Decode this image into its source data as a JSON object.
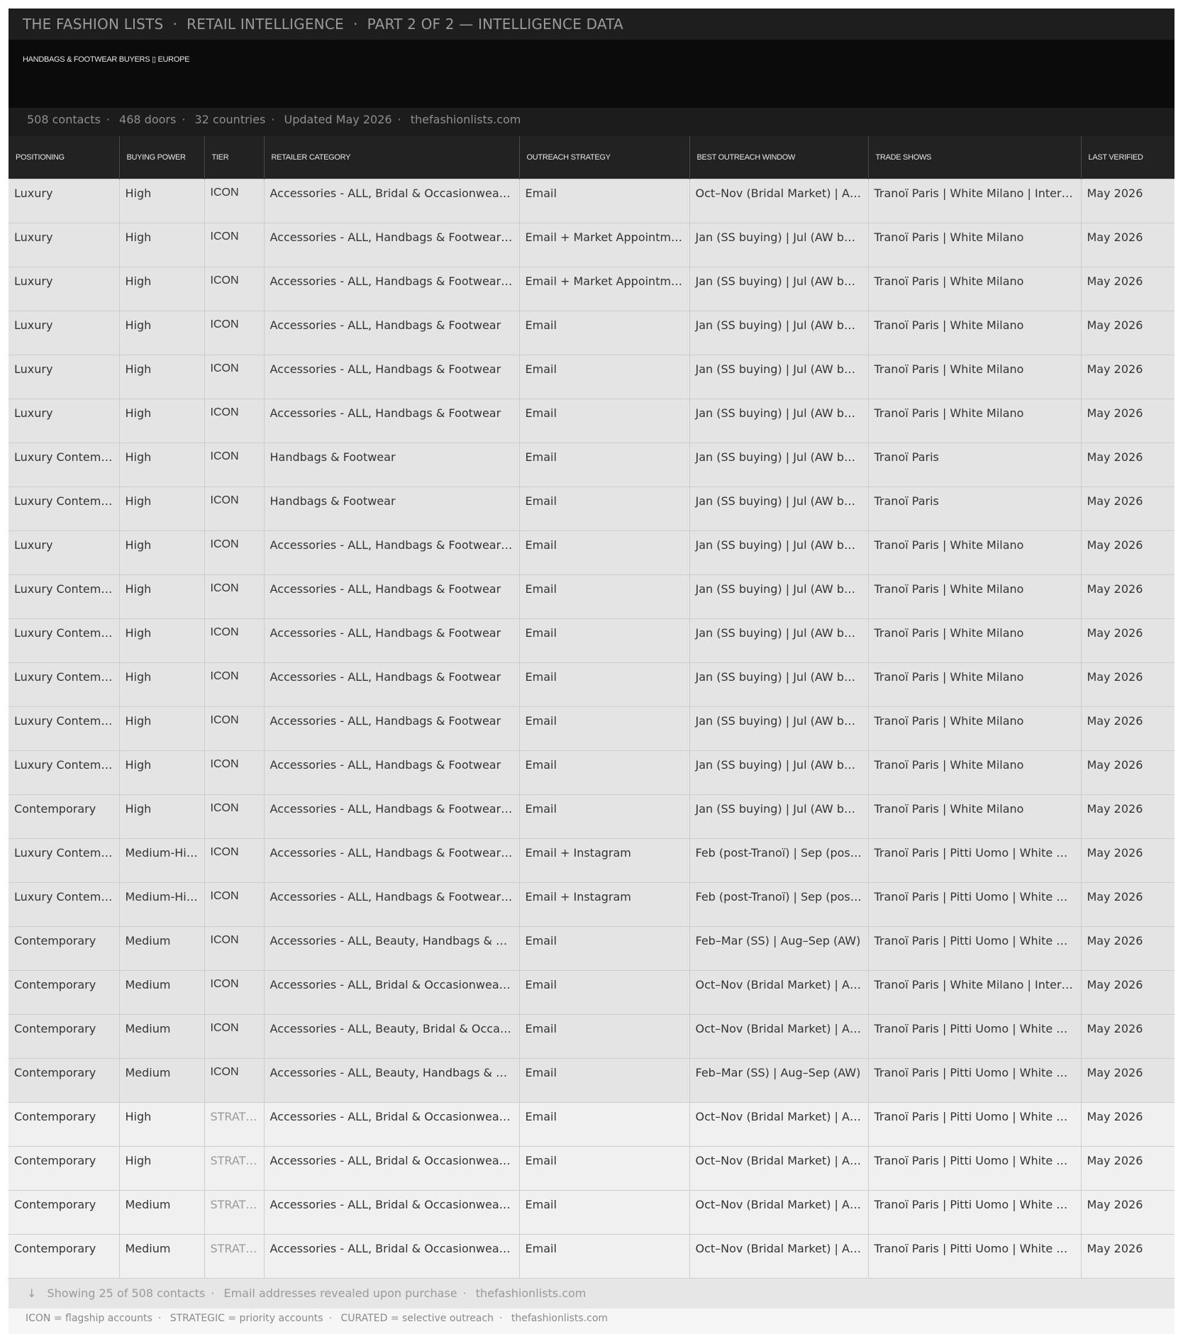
{
  "header": {
    "brand": "THE FASHION LISTS",
    "section": "RETAIL INTELLIGENCE",
    "part": "PART 2 OF 2 — INTELLIGENCE DATA",
    "subtitle": "HANDBAGS & FOOTWEAR BUYERS ▯ EUROPE"
  },
  "stats": {
    "contacts": "508 contacts",
    "doors": "468 doors",
    "countries": "32 countries",
    "updated": "Updated May 2026",
    "site": "thefashionlists.com"
  },
  "table": {
    "columns": [
      "POSITIONING",
      "BUYING POWER",
      "TIER",
      "RETAILER CATEGORY",
      "OUTREACH STRATEGY",
      "BEST OUTREACH WINDOW",
      "TRADE SHOWS",
      "LAST VERIFIED"
    ],
    "rows": [
      {
        "positioning": "Luxury",
        "buying_power": "High",
        "tier": "ICON",
        "category": "Accessories - ALL, Bridal & Occasionwear…",
        "outreach": "Email",
        "window": "Oct–Nov (Bridal Market) | A…",
        "trade_shows": "Tranoï Paris | White Milano | Inter…",
        "verified": "May 2026"
      },
      {
        "positioning": "Luxury",
        "buying_power": "High",
        "tier": "ICON",
        "category": "Accessories - ALL, Handbags & Footwear…",
        "outreach": "Email + Market Appointm…",
        "window": "Jan (SS buying) | Jul (AW bu…",
        "trade_shows": "Tranoï Paris | White Milano",
        "verified": "May 2026"
      },
      {
        "positioning": "Luxury",
        "buying_power": "High",
        "tier": "ICON",
        "category": "Accessories - ALL, Handbags & Footwear…",
        "outreach": "Email + Market Appointm…",
        "window": "Jan (SS buying) | Jul (AW bu…",
        "trade_shows": "Tranoï Paris | White Milano",
        "verified": "May 2026"
      },
      {
        "positioning": "Luxury",
        "buying_power": "High",
        "tier": "ICON",
        "category": "Accessories - ALL, Handbags & Footwear",
        "outreach": "Email",
        "window": "Jan (SS buying) | Jul (AW bu…",
        "trade_shows": "Tranoï Paris | White Milano",
        "verified": "May 2026"
      },
      {
        "positioning": "Luxury",
        "buying_power": "High",
        "tier": "ICON",
        "category": "Accessories - ALL, Handbags & Footwear",
        "outreach": "Email",
        "window": "Jan (SS buying) | Jul (AW bu…",
        "trade_shows": "Tranoï Paris | White Milano",
        "verified": "May 2026"
      },
      {
        "positioning": "Luxury",
        "buying_power": "High",
        "tier": "ICON",
        "category": "Accessories - ALL, Handbags & Footwear",
        "outreach": "Email",
        "window": "Jan (SS buying) | Jul (AW bu…",
        "trade_shows": "Tranoï Paris | White Milano",
        "verified": "May 2026"
      },
      {
        "positioning": "Luxury Contem…",
        "buying_power": "High",
        "tier": "ICON",
        "category": "Handbags & Footwear",
        "outreach": "Email",
        "window": "Jan (SS buying) | Jul (AW bu…",
        "trade_shows": "Tranoï Paris",
        "verified": "May 2026"
      },
      {
        "positioning": "Luxury Contem…",
        "buying_power": "High",
        "tier": "ICON",
        "category": "Handbags & Footwear",
        "outreach": "Email",
        "window": "Jan (SS buying) | Jul (AW bu…",
        "trade_shows": "Tranoï Paris",
        "verified": "May 2026"
      },
      {
        "positioning": "Luxury",
        "buying_power": "High",
        "tier": "ICON",
        "category": "Accessories - ALL, Handbags & Footwear…",
        "outreach": "Email",
        "window": "Jan (SS buying) | Jul (AW bu…",
        "trade_shows": "Tranoï Paris | White Milano",
        "verified": "May 2026"
      },
      {
        "positioning": "Luxury Contem…",
        "buying_power": "High",
        "tier": "ICON",
        "category": "Accessories - ALL, Handbags & Footwear",
        "outreach": "Email",
        "window": "Jan (SS buying) | Jul (AW bu…",
        "trade_shows": "Tranoï Paris | White Milano",
        "verified": "May 2026"
      },
      {
        "positioning": "Luxury Contem…",
        "buying_power": "High",
        "tier": "ICON",
        "category": "Accessories - ALL, Handbags & Footwear",
        "outreach": "Email",
        "window": "Jan (SS buying) | Jul (AW bu…",
        "trade_shows": "Tranoï Paris | White Milano",
        "verified": "May 2026"
      },
      {
        "positioning": "Luxury Contem…",
        "buying_power": "High",
        "tier": "ICON",
        "category": "Accessories - ALL, Handbags & Footwear",
        "outreach": "Email",
        "window": "Jan (SS buying) | Jul (AW bu…",
        "trade_shows": "Tranoï Paris | White Milano",
        "verified": "May 2026"
      },
      {
        "positioning": "Luxury Contem…",
        "buying_power": "High",
        "tier": "ICON",
        "category": "Accessories - ALL, Handbags & Footwear",
        "outreach": "Email",
        "window": "Jan (SS buying) | Jul (AW bu…",
        "trade_shows": "Tranoï Paris | White Milano",
        "verified": "May 2026"
      },
      {
        "positioning": "Luxury Contem…",
        "buying_power": "High",
        "tier": "ICON",
        "category": "Accessories - ALL, Handbags & Footwear",
        "outreach": "Email",
        "window": "Jan (SS buying) | Jul (AW bu…",
        "trade_shows": "Tranoï Paris | White Milano",
        "verified": "May 2026"
      },
      {
        "positioning": "Contemporary",
        "buying_power": "High",
        "tier": "ICON",
        "category": "Accessories - ALL, Handbags & Footwear…",
        "outreach": "Email",
        "window": "Jan (SS buying) | Jul (AW bu…",
        "trade_shows": "Tranoï Paris | White Milano",
        "verified": "May 2026"
      },
      {
        "positioning": "Luxury Contem…",
        "buying_power": "Medium-Hi…",
        "tier": "ICON",
        "category": "Accessories - ALL, Handbags & Footwear…",
        "outreach": "Email + Instagram",
        "window": "Feb (post-Tranoï) | Sep (pos…",
        "trade_shows": "Tranoï Paris | Pitti Uomo | White …",
        "verified": "May 2026"
      },
      {
        "positioning": "Luxury Contem…",
        "buying_power": "Medium-Hi…",
        "tier": "ICON",
        "category": "Accessories - ALL, Handbags & Footwear…",
        "outreach": "Email + Instagram",
        "window": "Feb (post-Tranoï) | Sep (pos…",
        "trade_shows": "Tranoï Paris | Pitti Uomo | White …",
        "verified": "May 2026"
      },
      {
        "positioning": "Contemporary",
        "buying_power": "Medium",
        "tier": "ICON",
        "category": "Accessories - ALL, Beauty, Handbags & F…",
        "outreach": "Email",
        "window": "Feb–Mar (SS) | Aug–Sep (AW)",
        "trade_shows": "Tranoï Paris | Pitti Uomo | White …",
        "verified": "May 2026"
      },
      {
        "positioning": "Contemporary",
        "buying_power": "Medium",
        "tier": "ICON",
        "category": "Accessories - ALL, Bridal & Occasionwear…",
        "outreach": "Email",
        "window": "Oct–Nov (Bridal Market) | A…",
        "trade_shows": "Tranoï Paris | White Milano | Inter…",
        "verified": "May 2026"
      },
      {
        "positioning": "Contemporary",
        "buying_power": "Medium",
        "tier": "ICON",
        "category": "Accessories - ALL, Beauty, Bridal & Occa…",
        "outreach": "Email",
        "window": "Oct–Nov (Bridal Market) | A…",
        "trade_shows": "Tranoï Paris | Pitti Uomo | White …",
        "verified": "May 2026"
      },
      {
        "positioning": "Contemporary",
        "buying_power": "Medium",
        "tier": "ICON",
        "category": "Accessories - ALL, Beauty, Handbags & F…",
        "outreach": "Email",
        "window": "Feb–Mar (SS) | Aug–Sep (AW)",
        "trade_shows": "Tranoï Paris | Pitti Uomo | White …",
        "verified": "May 2026"
      },
      {
        "positioning": "Contemporary",
        "buying_power": "High",
        "tier": "STRAT…",
        "category": "Accessories - ALL, Bridal & Occasionwear…",
        "outreach": "Email",
        "window": "Oct–Nov (Bridal Market) | A…",
        "trade_shows": "Tranoï Paris | Pitti Uomo | White …",
        "verified": "May 2026"
      },
      {
        "positioning": "Contemporary",
        "buying_power": "High",
        "tier": "STRAT…",
        "category": "Accessories - ALL, Bridal & Occasionwear…",
        "outreach": "Email",
        "window": "Oct–Nov (Bridal Market) | A…",
        "trade_shows": "Tranoï Paris | Pitti Uomo | White …",
        "verified": "May 2026"
      },
      {
        "positioning": "Contemporary",
        "buying_power": "Medium",
        "tier": "STRAT…",
        "category": "Accessories - ALL, Bridal & Occasionwear…",
        "outreach": "Email",
        "window": "Oct–Nov (Bridal Market) | A…",
        "trade_shows": "Tranoï Paris | Pitti Uomo | White …",
        "verified": "May 2026"
      },
      {
        "positioning": "Contemporary",
        "buying_power": "Medium",
        "tier": "STRAT…",
        "category": "Accessories - ALL, Bridal & Occasionwear…",
        "outreach": "Email",
        "window": "Oct–Nov (Bridal Market) | A…",
        "trade_shows": "Tranoï Paris | Pitti Uomo | White …",
        "verified": "May 2026"
      }
    ]
  },
  "footer": {
    "arrow": "↓",
    "showing": "Showing 25 of 508 contacts",
    "note": "Email addresses revealed upon purchase",
    "site": "thefashionlists.com"
  },
  "legend": {
    "icon": "ICON = flagship accounts",
    "strategic": "STRATEGIC = priority accounts",
    "curated": "CURATED = selective outreach",
    "site": "thefashionlists.com"
  },
  "colors": {
    "header_bg": "#1e1e1e",
    "title_bg": "#0b0b0b",
    "row_dark": "#e4e4e4",
    "row_light": "#f0f0f0"
  }
}
